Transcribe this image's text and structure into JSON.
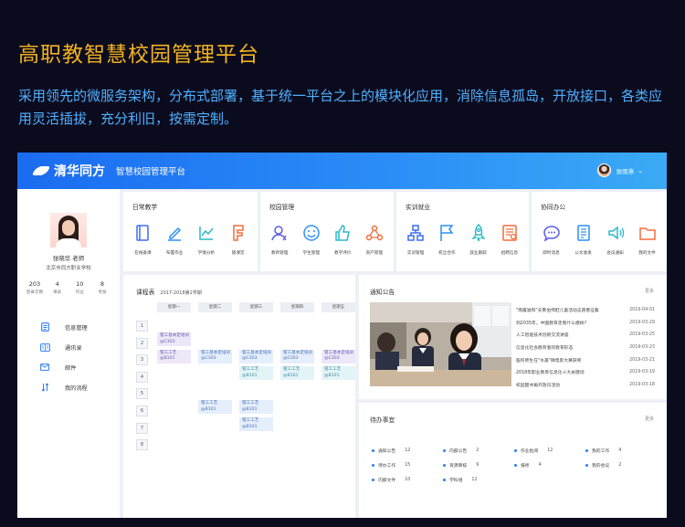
{
  "hero": {
    "title": "高职教智慧校园管理平台",
    "description": "采用领先的微服务架构，分布式部署，基于统一平台之上的模块化应用，消除信息孤岛，开放接口，各类应用灵活插拔，充分利旧，按需定制。"
  },
  "app": {
    "logo_text": "清华同方",
    "system_name": "智慧校园管理平台",
    "user_name": "张雨燕"
  },
  "profile": {
    "name": "张晓华 老师",
    "school": "北京市同方职业学校",
    "stats": [
      {
        "value": "203",
        "label": "登录次数"
      },
      {
        "value": "4",
        "label": "课表"
      },
      {
        "value": "10",
        "label": "作业"
      },
      {
        "value": "8",
        "label": "考核"
      }
    ],
    "menu": [
      {
        "label": "信息管理",
        "icon": "clipboard-icon"
      },
      {
        "label": "通讯录",
        "icon": "address-book-icon"
      },
      {
        "label": "邮件",
        "icon": "mail-icon"
      },
      {
        "label": "我的流程",
        "icon": "flow-icon"
      }
    ]
  },
  "modules": [
    {
      "title": "日常教学",
      "items": [
        {
          "label": "在线备课",
          "icon": "book-icon",
          "color": "#3d6df2"
        },
        {
          "label": "布置作业",
          "icon": "pencil-icon",
          "color": "#2f8ff4"
        },
        {
          "label": "学情分析",
          "icon": "chart-icon",
          "color": "#2bb8c9"
        },
        {
          "label": "随课堂",
          "icon": "flag-doc-icon",
          "color": "#f36d3b"
        }
      ]
    },
    {
      "title": "校园管理",
      "items": [
        {
          "label": "教师管理",
          "icon": "teacher-icon",
          "color": "#5a5ee8"
        },
        {
          "label": "学生管理",
          "icon": "smile-icon",
          "color": "#2f8ff4"
        },
        {
          "label": "教学评价",
          "icon": "thumb-icon",
          "color": "#2bb8c9"
        },
        {
          "label": "资产管理",
          "icon": "network-icon",
          "color": "#f36d3b"
        }
      ]
    },
    {
      "title": "实训就业",
      "items": [
        {
          "label": "实训管理",
          "icon": "org-icon",
          "color": "#3d6df2"
        },
        {
          "label": "校企合作",
          "icon": "flag-icon",
          "color": "#2f8ff4"
        },
        {
          "label": "就业跟踪",
          "icon": "rocket-icon",
          "color": "#2bb8c9"
        },
        {
          "label": "招聘信息",
          "icon": "news-icon",
          "color": "#f36d3b"
        }
      ]
    },
    {
      "title": "协同办公",
      "items": [
        {
          "label": "即时消息",
          "icon": "chat-icon",
          "color": "#5a5ee8"
        },
        {
          "label": "公文收发",
          "icon": "document-icon",
          "color": "#2f8ff4"
        },
        {
          "label": "会议通知",
          "icon": "speaker-icon",
          "color": "#2bb8c9"
        },
        {
          "label": "我的文件",
          "icon": "folder-icon",
          "color": "#f36d3b"
        }
      ]
    }
  ],
  "schedule": {
    "title": "课程表",
    "term": "2017-2018第2学期",
    "days": [
      "星期一",
      "星期二",
      "星期三",
      "星期四",
      "星期五"
    ],
    "periods": [
      "1",
      "2",
      "3",
      "4",
      "5",
      "6",
      "7",
      "8"
    ],
    "classes": [
      {
        "day": 0,
        "period": 1,
        "line1": "钳工基本定培训",
        "line2": "@C303",
        "color": "purple"
      },
      {
        "day": 0,
        "period": 2,
        "line1": "钳工工艺",
        "line2": "@B101",
        "color": "purple"
      },
      {
        "day": 1,
        "period": 2,
        "line1": "钳工基本定培训",
        "line2": "@C303",
        "color": "blue"
      },
      {
        "day": 2,
        "period": 2,
        "line1": "钳工基本定培训",
        "line2": "@C303",
        "color": "blue"
      },
      {
        "day": 3,
        "period": 2,
        "line1": "钳工基本定培训",
        "line2": "@C303",
        "color": "blue"
      },
      {
        "day": 4,
        "period": 2,
        "line1": "钳工基本定培训",
        "line2": "@C303",
        "color": "purple"
      },
      {
        "day": 2,
        "period": 3,
        "line1": "钳工工艺",
        "line2": "@B101",
        "color": "cyan"
      },
      {
        "day": 3,
        "period": 3,
        "line1": "钳工工艺",
        "line2": "@B101",
        "color": "cyan"
      },
      {
        "day": 4,
        "period": 3,
        "line1": "钳工工艺",
        "line2": "@B101",
        "color": "cyan"
      },
      {
        "day": 1,
        "period": 5,
        "line1": "钳工工艺",
        "line2": "@B101",
        "color": "blue"
      },
      {
        "day": 2,
        "period": 5,
        "line1": "钳工工艺",
        "line2": "@B101",
        "color": "blue"
      },
      {
        "day": 2,
        "period": 6,
        "line1": "钳工工艺",
        "line2": "@B101",
        "color": "blue"
      }
    ]
  },
  "notice": {
    "title": "通知公告",
    "more": "更多",
    "items": [
      {
        "title": "\"雨露滋和\"夫莱伯师赶儿童活动志愿者征集",
        "date": "2019-04-01"
      },
      {
        "title": "到2035年，中国教育走看什么模样?",
        "date": "2019-03-29"
      },
      {
        "title": "人工智能技术创新交流讲座",
        "date": "2019-03-25"
      },
      {
        "title": "信息化社会教育者的教育形态",
        "date": "2019-03-23"
      },
      {
        "title": "医校师生在\"水美\"微电影大赛获奖",
        "date": "2019-03-21"
      },
      {
        "title": "2018年职业教育信息化十大关键词",
        "date": "2019-03-19"
      },
      {
        "title": "校园图书角开放日活动",
        "date": "2019-03-18"
      }
    ]
  },
  "todo": {
    "title": "待办事宜",
    "more": "更多",
    "rows": [
      [
        {
          "label": "通知公告",
          "count": "12"
        },
        {
          "label": "内部公告",
          "count": "2"
        },
        {
          "label": "作业批阅",
          "count": "12"
        },
        {
          "label": "我的工作",
          "count": "4"
        }
      ],
      [
        {
          "label": "待办工作",
          "count": "15"
        },
        {
          "label": "资源审核",
          "count": "9"
        },
        {
          "label": "报修",
          "count": "4"
        },
        {
          "label": "我的会议",
          "count": "2"
        }
      ],
      [
        {
          "label": "内部文件",
          "count": "10"
        },
        {
          "label": "学科组",
          "count": "12"
        }
      ]
    ]
  }
}
